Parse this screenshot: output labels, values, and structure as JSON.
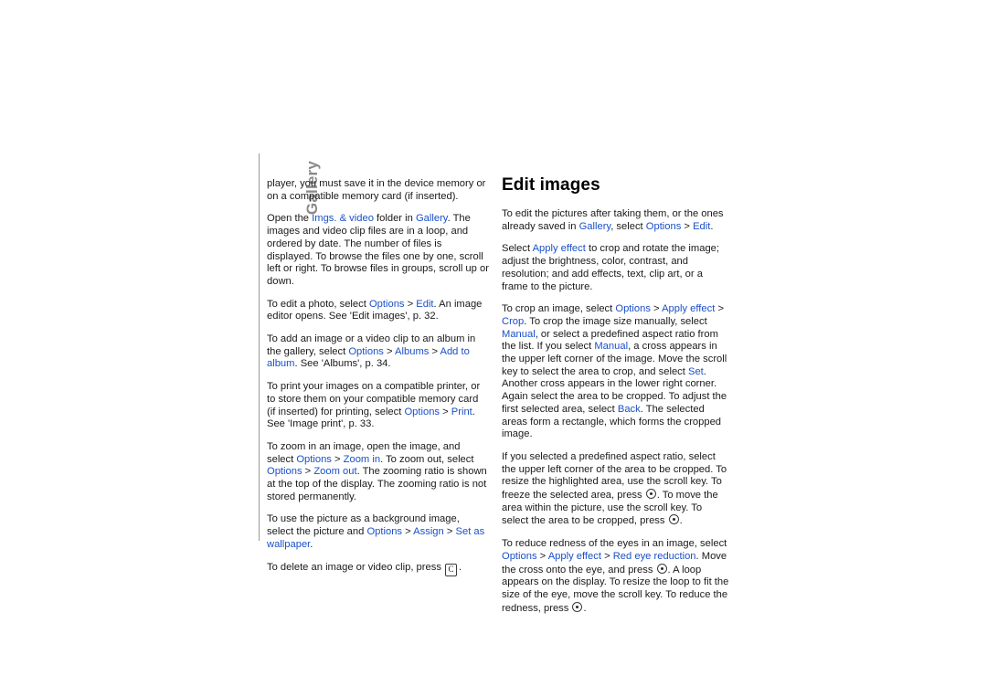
{
  "chapter": {
    "tab_label": "Gallery"
  },
  "left_column": {
    "paragraphs": [
      [
        {
          "t": "player, you must save it in the device memory or on a compatible memory card (if inserted)."
        }
      ],
      [
        {
          "t": "Open the "
        },
        {
          "t": "Imgs. & video",
          "k": "link"
        },
        {
          "t": " folder in "
        },
        {
          "t": "Gallery",
          "k": "link"
        },
        {
          "t": ". The images and video clip files are in a loop, and ordered by date. The number of files is displayed. To browse the files one by one, scroll left or right. To browse files in groups, scroll up or down."
        }
      ],
      [
        {
          "t": "To edit a photo, select "
        },
        {
          "t": "Options",
          "k": "link"
        },
        {
          "t": " > "
        },
        {
          "t": "Edit",
          "k": "link"
        },
        {
          "t": ". An image editor opens. See 'Edit images', p. 32."
        }
      ],
      [
        {
          "t": "To add an image or a video clip to an album in the gallery, select "
        },
        {
          "t": "Options",
          "k": "link"
        },
        {
          "t": " > "
        },
        {
          "t": "Albums",
          "k": "link"
        },
        {
          "t": " > "
        },
        {
          "t": "Add to album",
          "k": "link"
        },
        {
          "t": ". See 'Albums', p. 34."
        }
      ],
      [
        {
          "t": "To print your images on a compatible printer, or to store them on your compatible memory card (if inserted) for printing, select "
        },
        {
          "t": "Options",
          "k": "link"
        },
        {
          "t": " > "
        },
        {
          "t": "Print",
          "k": "link"
        },
        {
          "t": ". See 'Image print', p. 33."
        }
      ],
      [
        {
          "t": "To zoom in an image, open the image, and select "
        },
        {
          "t": "Options",
          "k": "link"
        },
        {
          "t": " > "
        },
        {
          "t": "Zoom in",
          "k": "link"
        },
        {
          "t": ". To zoom out, select "
        },
        {
          "t": "Options",
          "k": "link"
        },
        {
          "t": " > "
        },
        {
          "t": "Zoom out",
          "k": "link"
        },
        {
          "t": ". The zooming ratio is shown at the top of the display. The zooming ratio is not stored permanently."
        }
      ],
      [
        {
          "t": "To use the picture as a background image, select the picture and "
        },
        {
          "t": "Options",
          "k": "link"
        },
        {
          "t": " > "
        },
        {
          "t": "Assign",
          "k": "link"
        },
        {
          "t": " > "
        },
        {
          "t": "Set as wallpaper",
          "k": "link"
        },
        {
          "t": "."
        }
      ],
      [
        {
          "t": "To delete an image or video clip, press "
        },
        {
          "t": "",
          "k": "key-clear"
        },
        {
          "t": "."
        }
      ]
    ]
  },
  "right_column": {
    "heading": "Edit images",
    "paragraphs": [
      [
        {
          "t": "To edit the pictures after taking them, or the ones already saved in "
        },
        {
          "t": "Gallery",
          "k": "link"
        },
        {
          "t": ", select "
        },
        {
          "t": "Options",
          "k": "link"
        },
        {
          "t": " > "
        },
        {
          "t": "Edit",
          "k": "link"
        },
        {
          "t": "."
        }
      ],
      [
        {
          "t": "Select "
        },
        {
          "t": "Apply effect",
          "k": "link"
        },
        {
          "t": " to crop and rotate the image; adjust the brightness, color, contrast, and resolution; and add effects, text, clip art, or a frame to the picture."
        }
      ],
      [
        {
          "t": "To crop an image, select "
        },
        {
          "t": "Options",
          "k": "link"
        },
        {
          "t": " > "
        },
        {
          "t": "Apply effect",
          "k": "link"
        },
        {
          "t": " > "
        },
        {
          "t": "Crop",
          "k": "link"
        },
        {
          "t": ". To crop the image size manually, select "
        },
        {
          "t": "Manual",
          "k": "link"
        },
        {
          "t": ", or select a predefined aspect ratio from the list. If you select "
        },
        {
          "t": "Manual",
          "k": "link"
        },
        {
          "t": ", a cross appears in the upper left corner of the image. Move the scroll key to select the area to crop, and select "
        },
        {
          "t": "Set",
          "k": "link"
        },
        {
          "t": ". Another cross appears in the lower right corner. Again select the area to be cropped. To adjust the first selected area, select "
        },
        {
          "t": "Back",
          "k": "link"
        },
        {
          "t": ". The selected areas form a rectangle, which forms the cropped image."
        }
      ],
      [
        {
          "t": "If you selected a predefined aspect ratio, select the upper left corner of the area to be cropped. To resize the highlighted area, use the scroll key. To freeze the selected area, press "
        },
        {
          "t": "",
          "k": "key-round"
        },
        {
          "t": ". To move the area within the picture, use the scroll key. To select the area to be cropped, press "
        },
        {
          "t": "",
          "k": "key-round"
        },
        {
          "t": "."
        }
      ],
      [
        {
          "t": "To reduce redness of the eyes in an image, select "
        },
        {
          "t": "Options",
          "k": "link"
        },
        {
          "t": " > "
        },
        {
          "t": "Apply effect",
          "k": "link"
        },
        {
          "t": " > "
        },
        {
          "t": "Red eye reduction",
          "k": "link"
        },
        {
          "t": ". Move the cross onto the eye, and press "
        },
        {
          "t": "",
          "k": "key-round"
        },
        {
          "t": ". A loop appears on the display. To resize the loop to fit the size of the eye, move the scroll key. To reduce the redness, press "
        },
        {
          "t": "",
          "k": "key-round"
        },
        {
          "t": "."
        }
      ]
    ]
  }
}
